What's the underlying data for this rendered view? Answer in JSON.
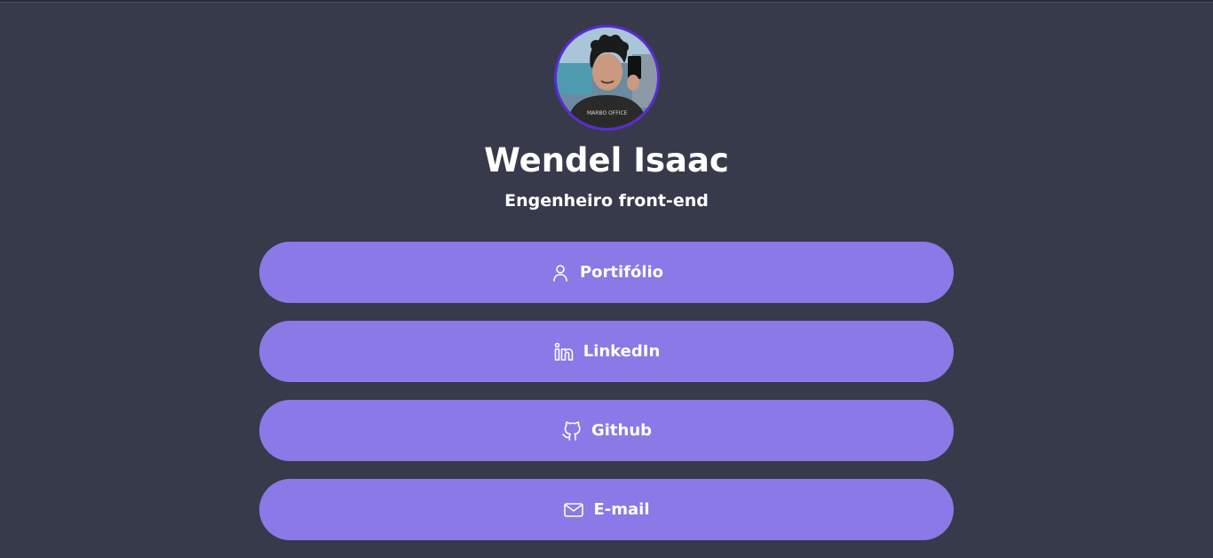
{
  "profile": {
    "name": "Wendel Isaac",
    "role": "Engenheiro front-end",
    "avatar_border_color": "#5b2bd6"
  },
  "links": [
    {
      "label": "Portifólio",
      "icon": "user-icon"
    },
    {
      "label": "LinkedIn",
      "icon": "linkedin-icon"
    },
    {
      "label": "Github",
      "icon": "github-icon"
    },
    {
      "label": "E-mail",
      "icon": "mail-icon"
    }
  ],
  "colors": {
    "background": "#363a4a",
    "button": "#8a79e6",
    "text": "#ffffff"
  }
}
